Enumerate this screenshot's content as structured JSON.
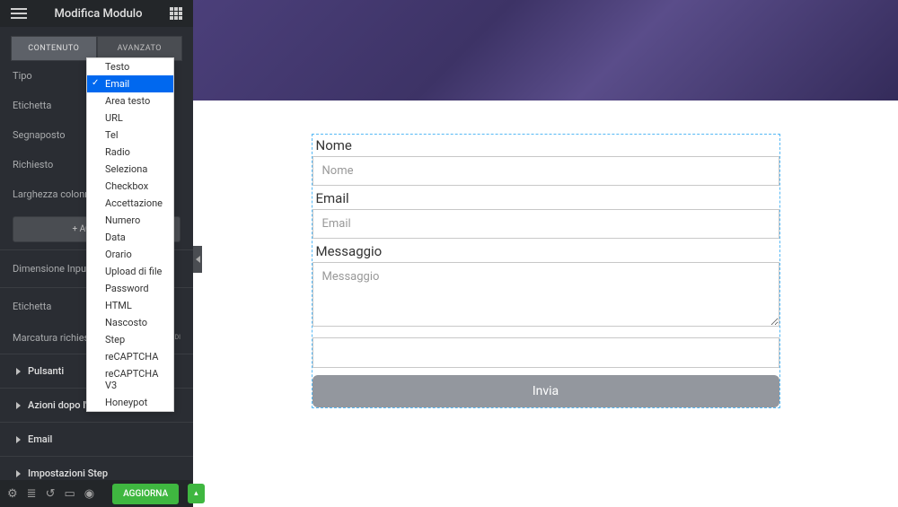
{
  "header": {
    "title": "Modifica Modulo"
  },
  "tabs": {
    "contenuto": "CONTENUTO",
    "avanzato": "AVANZATO"
  },
  "panel": {
    "tipo": "Tipo",
    "etichetta": "Etichetta",
    "segnaposto": "Segnaposto",
    "richiesto": "Richiesto",
    "larghezza": "Larghezza colonna",
    "aggiungi": "+   AGGIUNGI",
    "dim_input": "Dimensione Input",
    "etichetta2": "Etichetta",
    "marcatura": "Marcatura richiesta",
    "toggle_nascondi": "NASCONDI"
  },
  "accordion": {
    "pulsanti": "Pulsanti",
    "azioni": "Azioni dopo l'invio",
    "email": "Email",
    "step": "Impostazioni Step"
  },
  "dropdown": {
    "options": [
      "Testo",
      "Email",
      "Area testo",
      "URL",
      "Tel",
      "Radio",
      "Seleziona",
      "Checkbox",
      "Accettazione",
      "Numero",
      "Data",
      "Orario",
      "Upload di file",
      "Password",
      "HTML",
      "Nascosto",
      "Step",
      "reCAPTCHA",
      "reCAPTCHA V3",
      "Honeypot"
    ],
    "selected_index": 1
  },
  "form": {
    "nome_label": "Nome",
    "nome_ph": "Nome",
    "email_label": "Email",
    "email_ph": "Email",
    "msg_label": "Messaggio",
    "msg_ph": "Messaggio",
    "submit": "Invia"
  },
  "bottom": {
    "aggiorna": "AGGIORNA"
  }
}
